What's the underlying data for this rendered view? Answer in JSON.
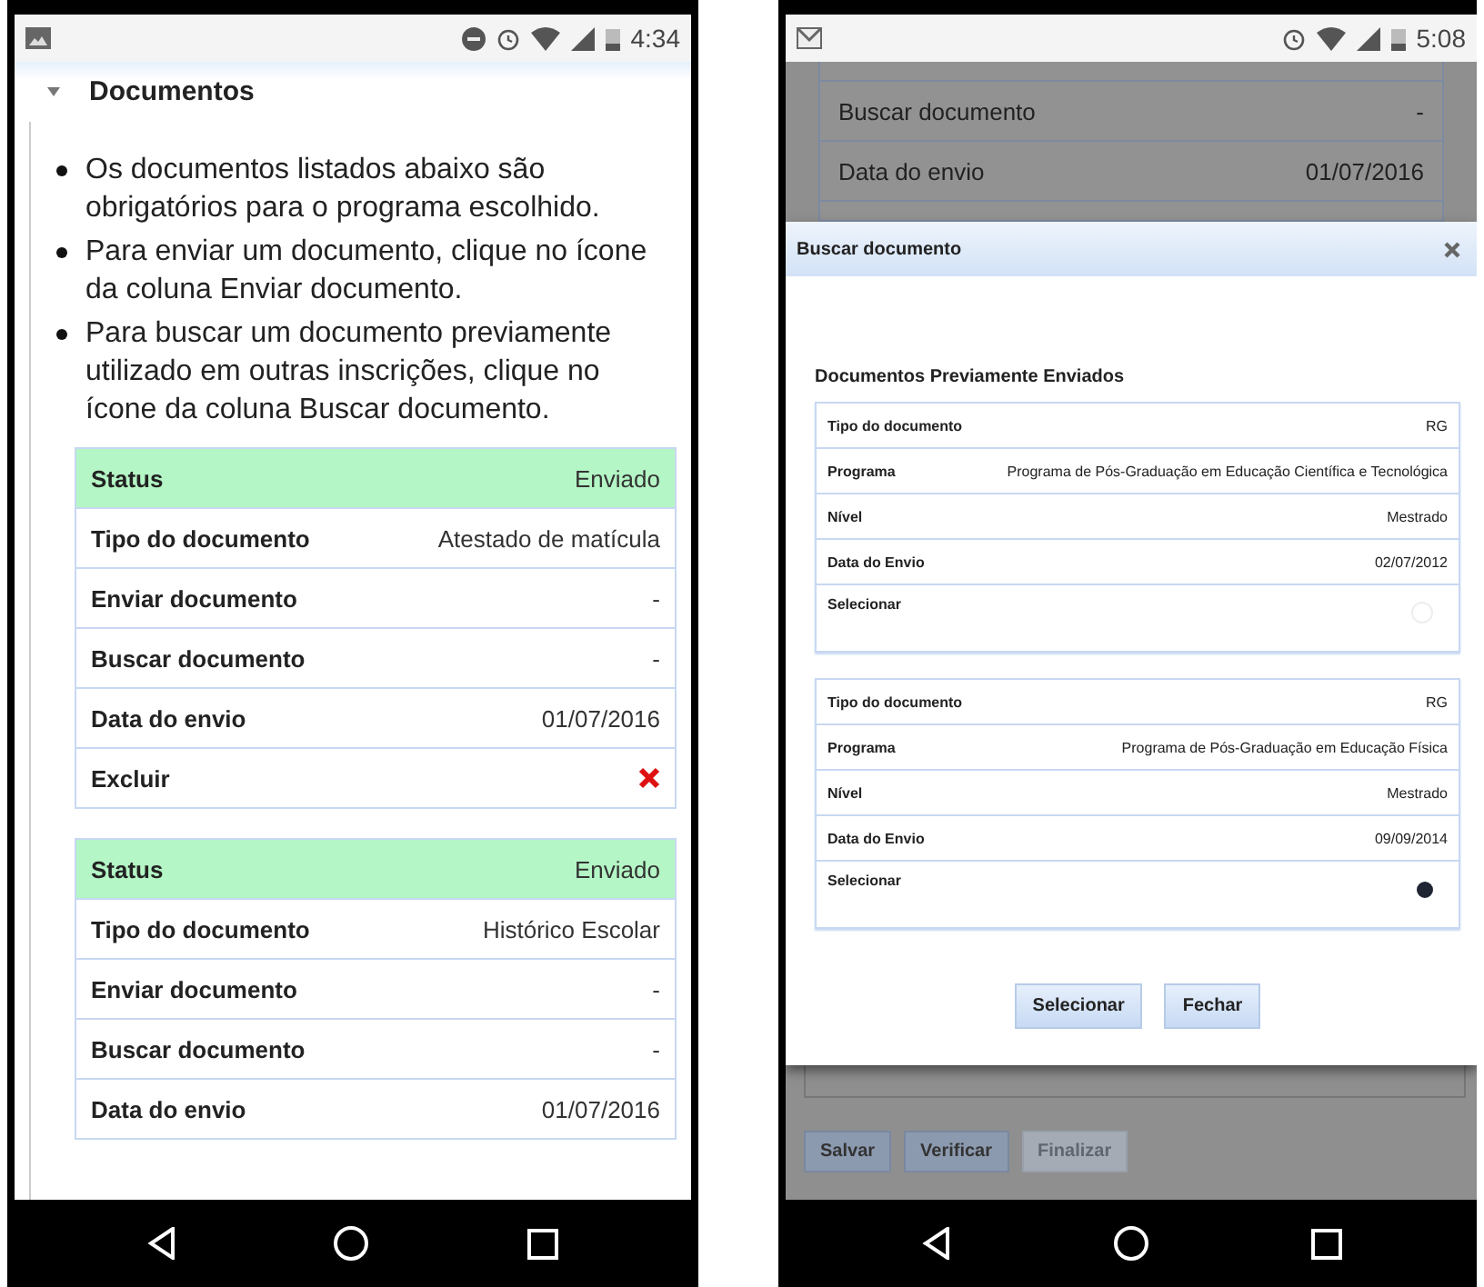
{
  "left": {
    "status_bar": {
      "time": "4:34"
    },
    "section": {
      "title": "Documentos",
      "expanded": true,
      "bullets": [
        "Os documentos listados abaixo são obrigatórios para o programa escolhido.",
        "Para enviar um documento, clique no ícone da coluna Enviar documento.",
        "Para buscar um documento previamente utilizado em outras inscrições, clique no ícone da coluna Buscar documento."
      ]
    },
    "documents": [
      {
        "rows": [
          {
            "kind": "status",
            "label": "Status",
            "value": "Enviado"
          },
          {
            "kind": "text",
            "label": "Tipo do documento",
            "value": "Atestado de matícula"
          },
          {
            "kind": "text",
            "label": "Enviar documento",
            "value": "-"
          },
          {
            "kind": "text",
            "label": "Buscar documento",
            "value": "-"
          },
          {
            "kind": "text",
            "label": "Data do envio",
            "value": "01/07/2016"
          },
          {
            "kind": "delete",
            "label": "Excluir"
          }
        ]
      },
      {
        "rows": [
          {
            "kind": "status",
            "label": "Status",
            "value": "Enviado"
          },
          {
            "kind": "text",
            "label": "Tipo do documento",
            "value": "Histórico Escolar"
          },
          {
            "kind": "text",
            "label": "Enviar documento",
            "value": "-"
          },
          {
            "kind": "text",
            "label": "Buscar documento",
            "value": "-"
          },
          {
            "kind": "text",
            "label": "Data do envio",
            "value": "01/07/2016"
          }
        ]
      }
    ]
  },
  "right": {
    "status_bar": {
      "time": "5:08"
    },
    "background_rows": [
      {
        "label": "Buscar documento",
        "value": "-"
      },
      {
        "label": "Data do envio",
        "value": "01/07/2016"
      }
    ],
    "dialog": {
      "title": "Buscar documento",
      "heading": "Documentos Previamente Enviados",
      "records": [
        {
          "selected": false,
          "fields": [
            {
              "label": "Tipo do documento",
              "value": "RG"
            },
            {
              "label": "Programa",
              "value": "Programa de Pós-Graduação em Educação Científica e Tecnológica"
            },
            {
              "label": "Nível",
              "value": "Mestrado"
            },
            {
              "label": "Data do Envio",
              "value": "02/07/2012"
            }
          ],
          "select_label": "Selecionar"
        },
        {
          "selected": true,
          "fields": [
            {
              "label": "Tipo do documento",
              "value": "RG"
            },
            {
              "label": "Programa",
              "value": "Programa de Pós-Graduação em Educação Física"
            },
            {
              "label": "Nível",
              "value": "Mestrado"
            },
            {
              "label": "Data do Envio",
              "value": "09/09/2014"
            }
          ],
          "select_label": "Selecionar"
        }
      ],
      "buttons": [
        "Selecionar",
        "Fechar"
      ]
    },
    "form_buttons": [
      {
        "label": "Salvar",
        "disabled": false
      },
      {
        "label": "Verificar",
        "disabled": false
      },
      {
        "label": "Finalizar",
        "disabled": true
      }
    ]
  }
}
